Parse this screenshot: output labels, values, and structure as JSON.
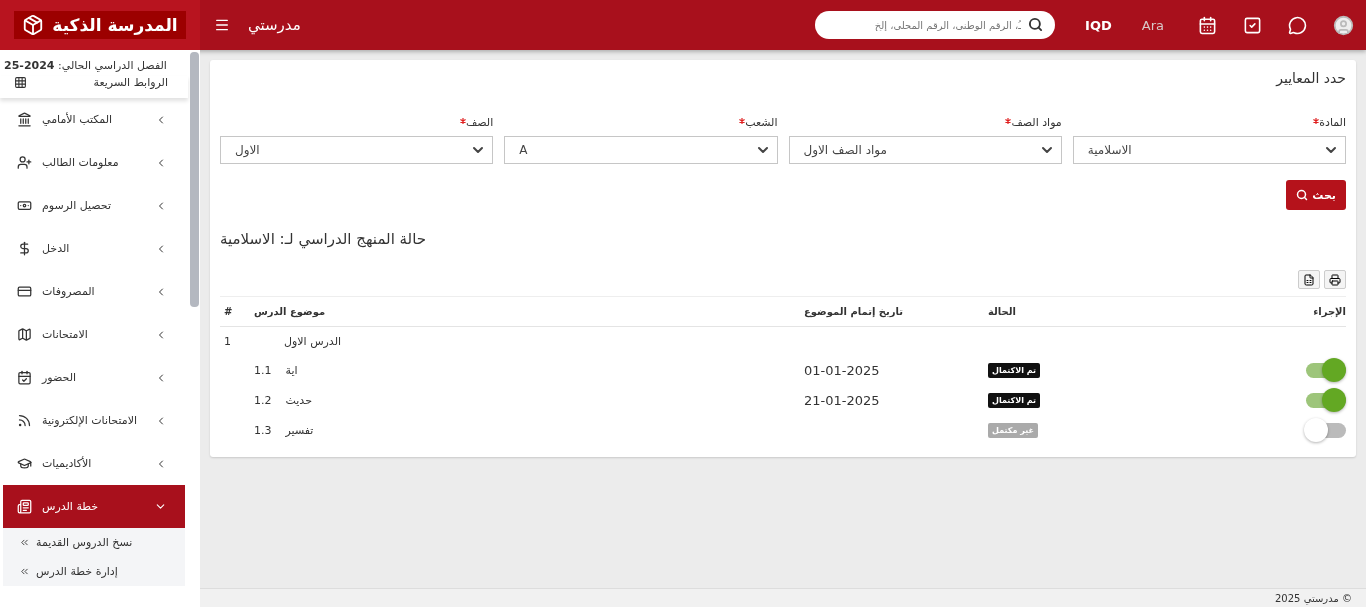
{
  "header": {
    "brand": "المدرسة الذكية",
    "title": "مدرستي",
    "search": {
      "placeholder": "ـُ، الرقم الوطني، الرقم المحلي، إلخ"
    },
    "currency": "IQD",
    "language": "Ara"
  },
  "sidebar": {
    "term": "الفصل الدراسي الحالي: **2024-25**",
    "quick_links": "الروابط السريعة",
    "items": [
      {
        "label": "المكتب الأمامي",
        "kind": "desk",
        "selected": false,
        "expanded": false
      },
      {
        "label": "معلومات الطالب",
        "kind": "student",
        "selected": false,
        "expanded": false
      },
      {
        "label": "تحصيل الرسوم",
        "kind": "fees",
        "selected": false,
        "expanded": false
      },
      {
        "label": "الدخل",
        "kind": "income",
        "selected": false,
        "expanded": false
      },
      {
        "label": "المصروفات",
        "kind": "expenses",
        "selected": false,
        "expanded": false
      },
      {
        "label": "الامتحانات",
        "kind": "exams",
        "selected": false,
        "expanded": false
      },
      {
        "label": "الحضور",
        "kind": "attendance",
        "selected": false,
        "expanded": false
      },
      {
        "label": "الامتحانات الإلكترونية",
        "kind": "online",
        "selected": false,
        "expanded": false
      },
      {
        "label": "الأكاديميات",
        "kind": "academics",
        "selected": false,
        "expanded": false
      },
      {
        "label": "خطة الدرس",
        "kind": "plan",
        "selected": true,
        "expanded": true,
        "children": [
          {
            "label": "نسخ الدروس القديمة"
          },
          {
            "label": "إدارة خطة الدرس"
          }
        ]
      }
    ]
  },
  "criteria": {
    "title": "حدد المعايير",
    "fields": [
      {
        "label": "المادة",
        "value": "الاسلامية",
        "required": true
      },
      {
        "label": "مواد الصف",
        "value": "مواد الصف الاول",
        "required": true
      },
      {
        "label": "الشعب",
        "value": "A",
        "required": true
      },
      {
        "label": "الصف",
        "value": "الاول",
        "required": true
      }
    ],
    "search_button": "بحث"
  },
  "syllabus": {
    "title": "حالة المنهج الدراسي لـ: الاسلامية",
    "table": {
      "columns": [
        "الإجراء",
        "الحالة",
        "تاريخ إتمام الموضوع",
        "موضوع الدرس",
        "#"
      ],
      "rows": [
        {
          "number": "1",
          "topic": "الدرس الاول",
          "children": [
            {
              "number": "1.1",
              "topic": "اية",
              "date": "01-01-2025",
              "status": "تم الاكتمال",
              "complete": true,
              "on": true
            },
            {
              "number": "1.2",
              "topic": "حديث",
              "date": "21-01-2025",
              "status": "تم الاكتمال",
              "complete": true,
              "on": true
            },
            {
              "number": "1.3",
              "topic": "تفسير",
              "status": "غير مكتمل",
              "complete": false,
              "on": false
            }
          ]
        }
      ]
    }
  },
  "footer": "مدرستي 2025 ©"
}
